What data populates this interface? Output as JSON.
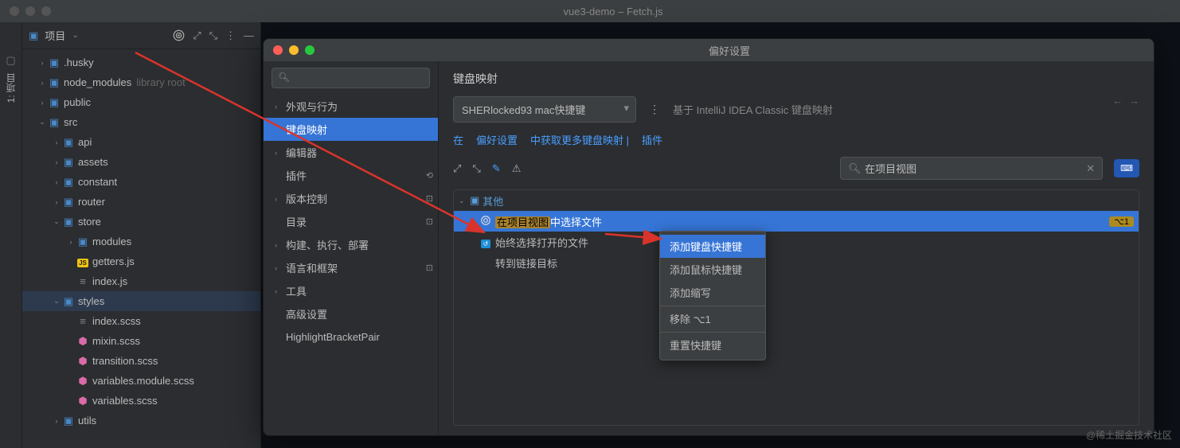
{
  "titlebar": {
    "title": "vue3-demo – Fetch.js"
  },
  "sideTab": {
    "label": "1: 项目"
  },
  "projectHeader": {
    "label": "项目"
  },
  "tree": [
    {
      "indent": 1,
      "chev": "›",
      "icon": "folder-dot",
      "name": ".husky"
    },
    {
      "indent": 1,
      "chev": "›",
      "icon": "folder-npm",
      "name": "node_modules",
      "dim": "library root"
    },
    {
      "indent": 1,
      "chev": "›",
      "icon": "folder",
      "name": "public"
    },
    {
      "indent": 1,
      "chev": "⌄",
      "icon": "folder-src",
      "name": "src"
    },
    {
      "indent": 2,
      "chev": "›",
      "icon": "folder",
      "name": "api"
    },
    {
      "indent": 2,
      "chev": "›",
      "icon": "folder",
      "name": "assets"
    },
    {
      "indent": 2,
      "chev": "›",
      "icon": "folder",
      "name": "constant"
    },
    {
      "indent": 2,
      "chev": "›",
      "icon": "folder-router",
      "name": "router"
    },
    {
      "indent": 2,
      "chev": "⌄",
      "icon": "folder-store",
      "name": "store"
    },
    {
      "indent": 3,
      "chev": "›",
      "icon": "folder",
      "name": "modules"
    },
    {
      "indent": 3,
      "chev": "",
      "icon": "js",
      "name": "getters.js"
    },
    {
      "indent": 3,
      "chev": "",
      "icon": "file",
      "name": "index.js"
    },
    {
      "indent": 2,
      "chev": "⌄",
      "icon": "folder",
      "name": "styles",
      "sel": true
    },
    {
      "indent": 3,
      "chev": "",
      "icon": "file",
      "name": "index.scss"
    },
    {
      "indent": 3,
      "chev": "",
      "icon": "scss",
      "name": "mixin.scss"
    },
    {
      "indent": 3,
      "chev": "",
      "icon": "scss",
      "name": "transition.scss"
    },
    {
      "indent": 3,
      "chev": "",
      "icon": "scss",
      "name": "variables.module.scss"
    },
    {
      "indent": 3,
      "chev": "",
      "icon": "scss",
      "name": "variables.scss"
    },
    {
      "indent": 2,
      "chev": "›",
      "icon": "folder",
      "name": "utils"
    }
  ],
  "prefs": {
    "title": "偏好设置",
    "sidebarSearchPlaceholder": "",
    "nav": [
      {
        "label": "外观与行为",
        "chev": "›"
      },
      {
        "label": "键盘映射",
        "active": true
      },
      {
        "label": "编辑器",
        "chev": "›"
      },
      {
        "label": "插件",
        "marker": "⟲"
      },
      {
        "label": "版本控制",
        "chev": "›",
        "marker": "⊡"
      },
      {
        "label": "目录",
        "marker": "⊡"
      },
      {
        "label": "构建、执行、部署",
        "chev": "›"
      },
      {
        "label": "语言和框架",
        "chev": "›",
        "marker": "⊡"
      },
      {
        "label": "工具",
        "chev": "›"
      },
      {
        "label": "高级设置"
      },
      {
        "label": "HighlightBracketPair"
      }
    ],
    "contentTitle": "键盘映射",
    "scheme": "SHERlocked93 mac快捷键",
    "hint": "基于 IntelliJ IDEA Classic 键盘映射",
    "linkLine": {
      "l1": "在",
      "l2": "偏好设置",
      "l3": "中获取更多键盘映射 |",
      "l4": "插件"
    },
    "searchValue": "在项目视图",
    "keymapCat": "其他",
    "keymapItems": [
      {
        "label_hl": "在项目视图",
        "label_rest": "中选择文件",
        "sel": true,
        "icon": "target",
        "shortcut": "⌥1"
      },
      {
        "label": "始终选择打开的文件",
        "icon": "always"
      },
      {
        "label": "转到链接目标"
      }
    ]
  },
  "contextMenu": [
    {
      "label": "添加键盘快捷键",
      "active": true
    },
    {
      "label": "添加鼠标快捷键"
    },
    {
      "label": "添加缩写"
    },
    {
      "label": "移除 ⌥1",
      "sep": true
    },
    {
      "label": "重置快捷键",
      "sep": true
    }
  ],
  "watermark": "@稀土掘金技术社区"
}
